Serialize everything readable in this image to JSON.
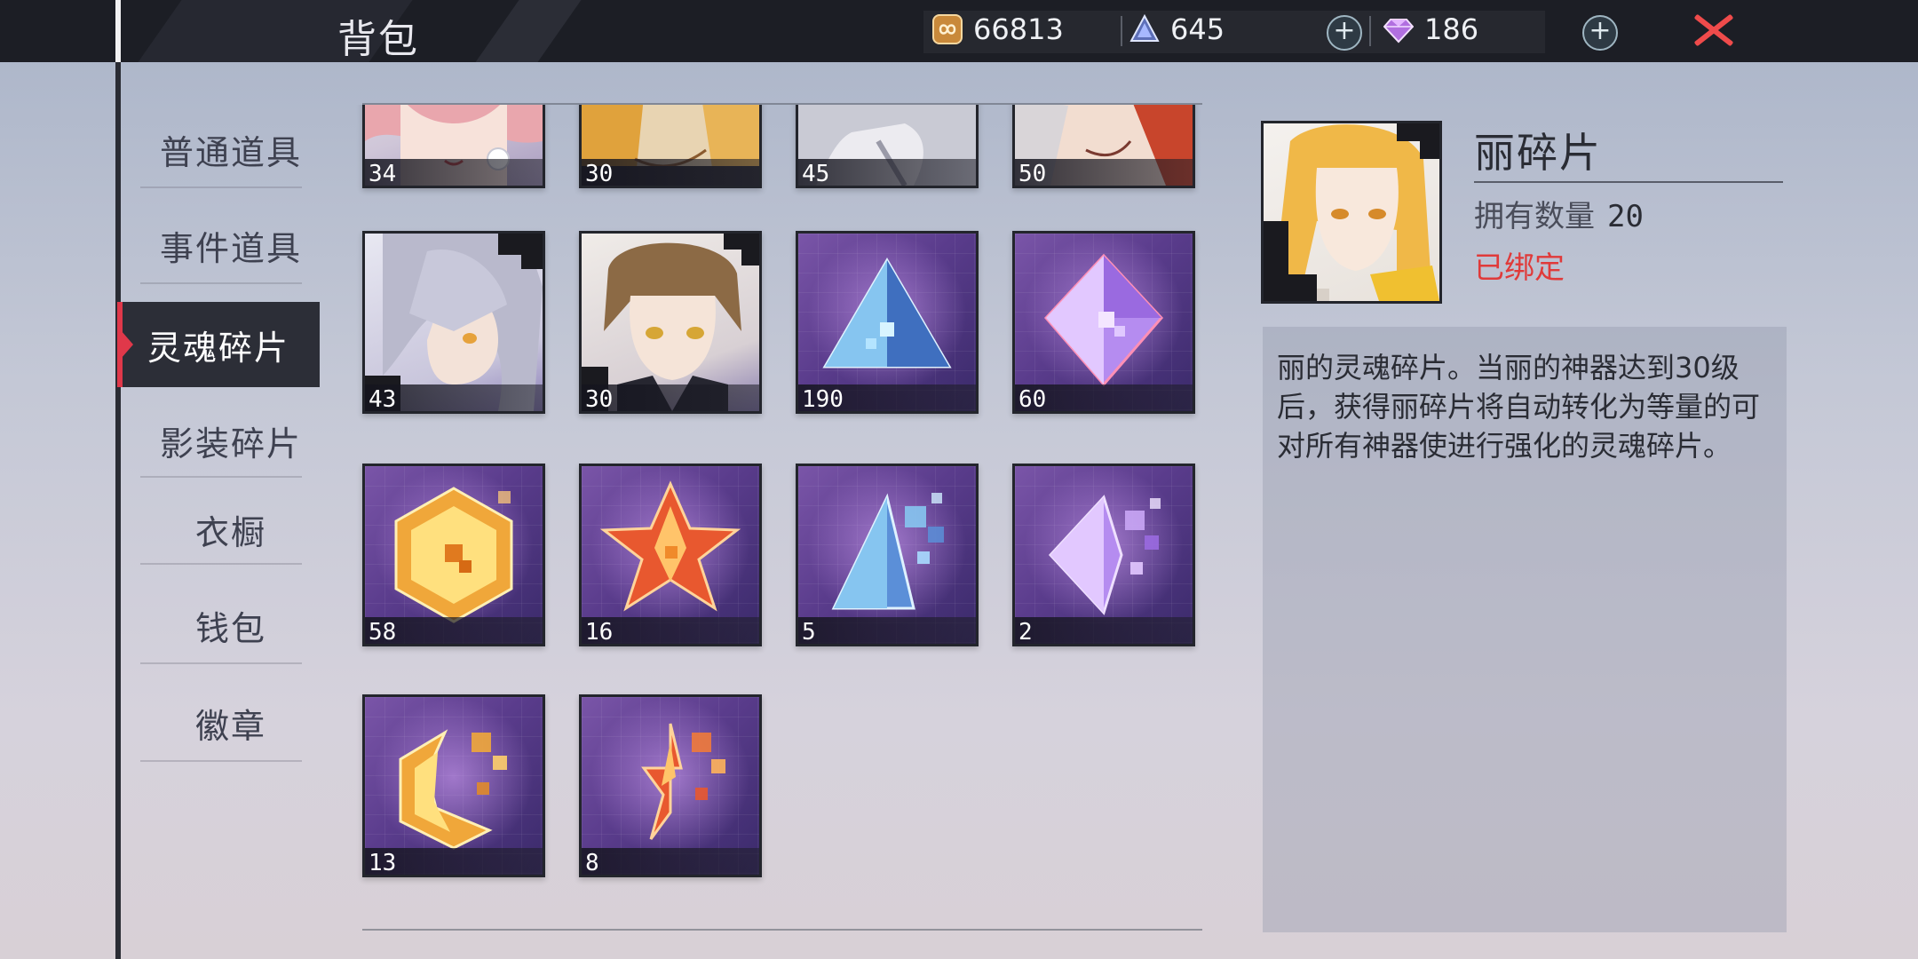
{
  "header": {
    "title": "背包",
    "currencies": [
      {
        "icon": "gold-coin-icon",
        "value": "66813"
      },
      {
        "icon": "crystal-pyramid-icon",
        "value": "645"
      },
      {
        "icon": "diamond-gem-icon",
        "value": "186"
      }
    ],
    "plus_label": "+",
    "close_icon": "close-icon"
  },
  "sidebar": {
    "items": [
      {
        "label": "普通道具"
      },
      {
        "label": "事件道具"
      },
      {
        "label": "灵魂碎片",
        "active": true
      },
      {
        "label": "影装碎片"
      },
      {
        "label": "衣橱"
      },
      {
        "label": "钱包"
      },
      {
        "label": "徽章"
      }
    ]
  },
  "grid": {
    "items": [
      {
        "kind": "portrait-pink-hair",
        "count": "34"
      },
      {
        "kind": "portrait-blonde",
        "count": "30"
      },
      {
        "kind": "portrait-silver",
        "count": "45"
      },
      {
        "kind": "portrait-redhead",
        "count": "50"
      },
      {
        "kind": "portrait-silver-hair-girl",
        "count": "43"
      },
      {
        "kind": "portrait-brown-hair-boy",
        "count": "30"
      },
      {
        "kind": "shard-blue-pyramid",
        "count": "190"
      },
      {
        "kind": "shard-purple-octahedron",
        "count": "60"
      },
      {
        "kind": "shard-gold-hexagon",
        "count": "58"
      },
      {
        "kind": "shard-red-star",
        "count": "16"
      },
      {
        "kind": "shard-blue-pyramid-fragment",
        "count": "5"
      },
      {
        "kind": "shard-purple-octahedron-fragment",
        "count": "2"
      },
      {
        "kind": "shard-gold-hexagon-fragment",
        "count": "13"
      },
      {
        "kind": "shard-red-star-fragment",
        "count": "8"
      }
    ]
  },
  "detail": {
    "name": "丽碎片",
    "owned_label": "拥有数量",
    "owned_count": "20",
    "bound_status": "已绑定",
    "description": "丽的灵魂碎片。当丽的神器达到30级后，获得丽碎片将自动转化为等量的可对所有神器使进行强化的灵魂碎片。"
  },
  "colors": {
    "accent_red": "#e0384a",
    "bound_red": "#e03a3a",
    "topbar": "#1c1e25"
  }
}
